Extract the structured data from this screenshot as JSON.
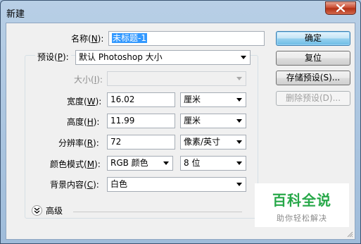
{
  "window": {
    "title": "新建"
  },
  "form": {
    "name": {
      "label": "名称(",
      "key": "N",
      "label_end": "):",
      "value": "未标题-1"
    },
    "preset": {
      "label": "预设(",
      "key": "P",
      "label_end": "):",
      "value": "默认 Photoshop 大小"
    },
    "size": {
      "label": "大小(",
      "key": "I",
      "label_end": "):",
      "value": ""
    },
    "width": {
      "label": "宽度(",
      "key": "W",
      "label_end": "):",
      "value": "16.02",
      "unit": "厘米"
    },
    "height": {
      "label": "高度(",
      "key": "H",
      "label_end": "):",
      "value": "11.99",
      "unit": "厘米"
    },
    "resolution": {
      "label": "分辨率(",
      "key": "R",
      "label_end": "):",
      "value": "72",
      "unit": "像素/英寸"
    },
    "color_mode": {
      "label": "颜色模式(",
      "key": "M",
      "label_end": "):",
      "value": "RGB 颜色",
      "depth": "8 位"
    },
    "background": {
      "label": "背景内容(",
      "key": "C",
      "label_end": "):",
      "value": "白色"
    },
    "advanced": {
      "label": "高级"
    }
  },
  "buttons": {
    "ok": "确定",
    "reset": "复位",
    "save_preset": "存储预设(S)...",
    "delete_preset": "删除预设(D)..."
  },
  "watermark": {
    "main": "百科全说",
    "sub": "助你轻松解决"
  },
  "colors": {
    "selection": "#3399ff",
    "watermark_green": "#27a849"
  }
}
